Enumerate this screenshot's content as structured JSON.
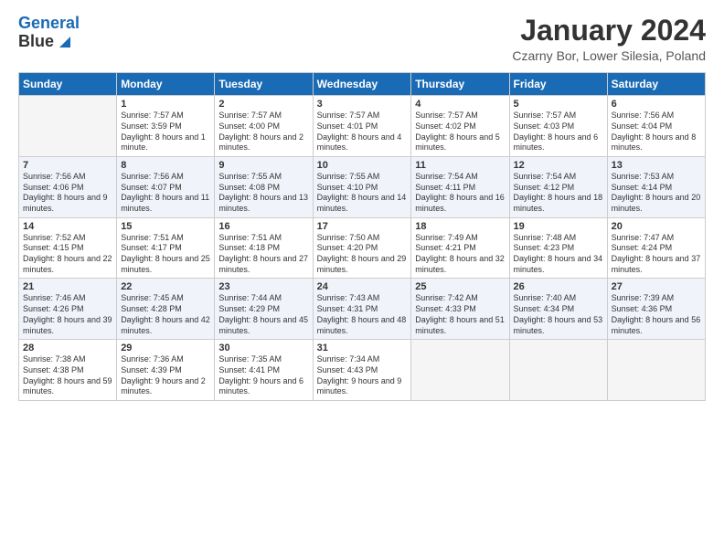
{
  "header": {
    "logo_line1": "General",
    "logo_line2": "Blue",
    "title": "January 2024",
    "subtitle": "Czarny Bor, Lower Silesia, Poland"
  },
  "calendar": {
    "days_of_week": [
      "Sunday",
      "Monday",
      "Tuesday",
      "Wednesday",
      "Thursday",
      "Friday",
      "Saturday"
    ],
    "weeks": [
      [
        {
          "num": "",
          "sunrise": "",
          "sunset": "",
          "daylight": "",
          "empty": true
        },
        {
          "num": "1",
          "sunrise": "Sunrise: 7:57 AM",
          "sunset": "Sunset: 3:59 PM",
          "daylight": "Daylight: 8 hours and 1 minute."
        },
        {
          "num": "2",
          "sunrise": "Sunrise: 7:57 AM",
          "sunset": "Sunset: 4:00 PM",
          "daylight": "Daylight: 8 hours and 2 minutes."
        },
        {
          "num": "3",
          "sunrise": "Sunrise: 7:57 AM",
          "sunset": "Sunset: 4:01 PM",
          "daylight": "Daylight: 8 hours and 4 minutes."
        },
        {
          "num": "4",
          "sunrise": "Sunrise: 7:57 AM",
          "sunset": "Sunset: 4:02 PM",
          "daylight": "Daylight: 8 hours and 5 minutes."
        },
        {
          "num": "5",
          "sunrise": "Sunrise: 7:57 AM",
          "sunset": "Sunset: 4:03 PM",
          "daylight": "Daylight: 8 hours and 6 minutes."
        },
        {
          "num": "6",
          "sunrise": "Sunrise: 7:56 AM",
          "sunset": "Sunset: 4:04 PM",
          "daylight": "Daylight: 8 hours and 8 minutes."
        }
      ],
      [
        {
          "num": "7",
          "sunrise": "Sunrise: 7:56 AM",
          "sunset": "Sunset: 4:06 PM",
          "daylight": "Daylight: 8 hours and 9 minutes."
        },
        {
          "num": "8",
          "sunrise": "Sunrise: 7:56 AM",
          "sunset": "Sunset: 4:07 PM",
          "daylight": "Daylight: 8 hours and 11 minutes."
        },
        {
          "num": "9",
          "sunrise": "Sunrise: 7:55 AM",
          "sunset": "Sunset: 4:08 PM",
          "daylight": "Daylight: 8 hours and 13 minutes."
        },
        {
          "num": "10",
          "sunrise": "Sunrise: 7:55 AM",
          "sunset": "Sunset: 4:10 PM",
          "daylight": "Daylight: 8 hours and 14 minutes."
        },
        {
          "num": "11",
          "sunrise": "Sunrise: 7:54 AM",
          "sunset": "Sunset: 4:11 PM",
          "daylight": "Daylight: 8 hours and 16 minutes."
        },
        {
          "num": "12",
          "sunrise": "Sunrise: 7:54 AM",
          "sunset": "Sunset: 4:12 PM",
          "daylight": "Daylight: 8 hours and 18 minutes."
        },
        {
          "num": "13",
          "sunrise": "Sunrise: 7:53 AM",
          "sunset": "Sunset: 4:14 PM",
          "daylight": "Daylight: 8 hours and 20 minutes."
        }
      ],
      [
        {
          "num": "14",
          "sunrise": "Sunrise: 7:52 AM",
          "sunset": "Sunset: 4:15 PM",
          "daylight": "Daylight: 8 hours and 22 minutes."
        },
        {
          "num": "15",
          "sunrise": "Sunrise: 7:51 AM",
          "sunset": "Sunset: 4:17 PM",
          "daylight": "Daylight: 8 hours and 25 minutes."
        },
        {
          "num": "16",
          "sunrise": "Sunrise: 7:51 AM",
          "sunset": "Sunset: 4:18 PM",
          "daylight": "Daylight: 8 hours and 27 minutes."
        },
        {
          "num": "17",
          "sunrise": "Sunrise: 7:50 AM",
          "sunset": "Sunset: 4:20 PM",
          "daylight": "Daylight: 8 hours and 29 minutes."
        },
        {
          "num": "18",
          "sunrise": "Sunrise: 7:49 AM",
          "sunset": "Sunset: 4:21 PM",
          "daylight": "Daylight: 8 hours and 32 minutes."
        },
        {
          "num": "19",
          "sunrise": "Sunrise: 7:48 AM",
          "sunset": "Sunset: 4:23 PM",
          "daylight": "Daylight: 8 hours and 34 minutes."
        },
        {
          "num": "20",
          "sunrise": "Sunrise: 7:47 AM",
          "sunset": "Sunset: 4:24 PM",
          "daylight": "Daylight: 8 hours and 37 minutes."
        }
      ],
      [
        {
          "num": "21",
          "sunrise": "Sunrise: 7:46 AM",
          "sunset": "Sunset: 4:26 PM",
          "daylight": "Daylight: 8 hours and 39 minutes."
        },
        {
          "num": "22",
          "sunrise": "Sunrise: 7:45 AM",
          "sunset": "Sunset: 4:28 PM",
          "daylight": "Daylight: 8 hours and 42 minutes."
        },
        {
          "num": "23",
          "sunrise": "Sunrise: 7:44 AM",
          "sunset": "Sunset: 4:29 PM",
          "daylight": "Daylight: 8 hours and 45 minutes."
        },
        {
          "num": "24",
          "sunrise": "Sunrise: 7:43 AM",
          "sunset": "Sunset: 4:31 PM",
          "daylight": "Daylight: 8 hours and 48 minutes."
        },
        {
          "num": "25",
          "sunrise": "Sunrise: 7:42 AM",
          "sunset": "Sunset: 4:33 PM",
          "daylight": "Daylight: 8 hours and 51 minutes."
        },
        {
          "num": "26",
          "sunrise": "Sunrise: 7:40 AM",
          "sunset": "Sunset: 4:34 PM",
          "daylight": "Daylight: 8 hours and 53 minutes."
        },
        {
          "num": "27",
          "sunrise": "Sunrise: 7:39 AM",
          "sunset": "Sunset: 4:36 PM",
          "daylight": "Daylight: 8 hours and 56 minutes."
        }
      ],
      [
        {
          "num": "28",
          "sunrise": "Sunrise: 7:38 AM",
          "sunset": "Sunset: 4:38 PM",
          "daylight": "Daylight: 8 hours and 59 minutes."
        },
        {
          "num": "29",
          "sunrise": "Sunrise: 7:36 AM",
          "sunset": "Sunset: 4:39 PM",
          "daylight": "Daylight: 9 hours and 2 minutes."
        },
        {
          "num": "30",
          "sunrise": "Sunrise: 7:35 AM",
          "sunset": "Sunset: 4:41 PM",
          "daylight": "Daylight: 9 hours and 6 minutes."
        },
        {
          "num": "31",
          "sunrise": "Sunrise: 7:34 AM",
          "sunset": "Sunset: 4:43 PM",
          "daylight": "Daylight: 9 hours and 9 minutes."
        },
        {
          "num": "",
          "sunrise": "",
          "sunset": "",
          "daylight": "",
          "empty": true
        },
        {
          "num": "",
          "sunrise": "",
          "sunset": "",
          "daylight": "",
          "empty": true
        },
        {
          "num": "",
          "sunrise": "",
          "sunset": "",
          "daylight": "",
          "empty": true
        }
      ]
    ]
  }
}
